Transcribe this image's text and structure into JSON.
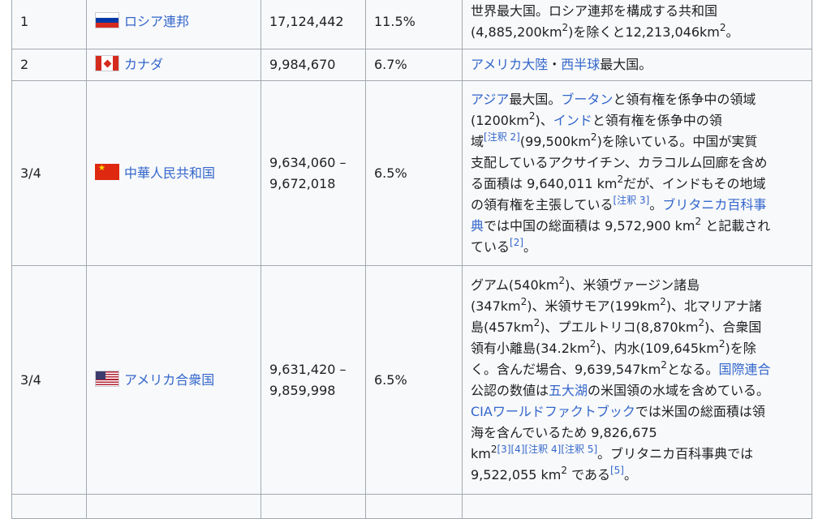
{
  "rows": [
    {
      "rank": "1",
      "flag": "russia-flag",
      "country": "ロシア連邦",
      "area": "17,124,442",
      "pct": "11.5%",
      "note_a": "世界最大国。ロシア連邦を構成する共和国",
      "note_b": "(4,885,200km",
      "note_c": ")を除くと12,213,046km",
      "note_d": "。"
    },
    {
      "rank": "2",
      "flag": "canada-flag",
      "country": "カナダ",
      "area": "9,984,670",
      "pct": "6.7%",
      "link_americas": "アメリカ大陸",
      "dot": "・",
      "link_western": "西半球",
      "note_tail": "最大国。"
    },
    {
      "rank": "3/4",
      "flag": "china-flag",
      "country": "中華人民共和国",
      "area_min": "9,634,060 –",
      "area_max": "9,672,018",
      "pct": "6.5%",
      "link_asia": "アジア",
      "t1": "最大国。",
      "link_bhutan": "ブータン",
      "t2": "と領有権を係争中の領域",
      "t3": "(1200km",
      "t4": ")、",
      "link_india": "インド",
      "t5": "と領有権を係争中の領",
      "t6": "域",
      "ref_note2": "[注釈 2]",
      "t7": "(99,500km",
      "t8": ")を除いている。中国が実質",
      "t9": "支配しているアクサイチン、カラコルム回廊を含め",
      "t10": "る面積は 9,640,011 km",
      "t11": "だが、インドもその地域",
      "t12": "の領有権を主張している",
      "ref_note3": "[注釈 3]",
      "t13": "。",
      "link_britannica_a": "ブリタニカ百科事",
      "link_britannica_b": "典",
      "t14": "では中国の総面積は 9,572,900 km",
      "t15": " と記載され",
      "t16": "ている",
      "ref_2": "[2]",
      "t17": "。"
    },
    {
      "rank": "3/4",
      "flag": "usa-flag",
      "country": "アメリカ合衆国",
      "area_min": "9,631,420 –",
      "area_max": "9,859,998",
      "pct": "6.5%",
      "u1": "グアム(540km",
      "u2": ")、米領ヴァージン諸島",
      "u3": "(347km",
      "u4": ")、米領サモア(199km",
      "u5": ")、北マリアナ諸",
      "u6": "島(457km",
      "u7": ")、プエルトリコ(8,870km",
      "u8": ")、合衆国",
      "u9": "領有小離島(34.2km",
      "u10": ")、内水(109,645km",
      "u11": ")を除",
      "u12": "く。含んだ場合、9,639,547km",
      "u13": "となる。",
      "link_un": "国際連合",
      "u14": "公認の数値は",
      "link_greatlakes": "五大湖",
      "u15": "の米国領の水域を含めている。",
      "link_cia": "CIAワールドファクトブック",
      "u16": "では米国の総面積は領",
      "u17": "海を含んでいるため 9,826,675",
      "u18": "km",
      "ref_3": "[3]",
      "ref_4": "[4]",
      "ref_note4": "[注釈 4]",
      "ref_note5": "[注釈 5]",
      "u19": "。ブリタニカ百科事典では",
      "u20": "9,522,055 km",
      "u21": " である",
      "ref_5": "[5]",
      "u22": "。"
    }
  ],
  "sup2": "2"
}
